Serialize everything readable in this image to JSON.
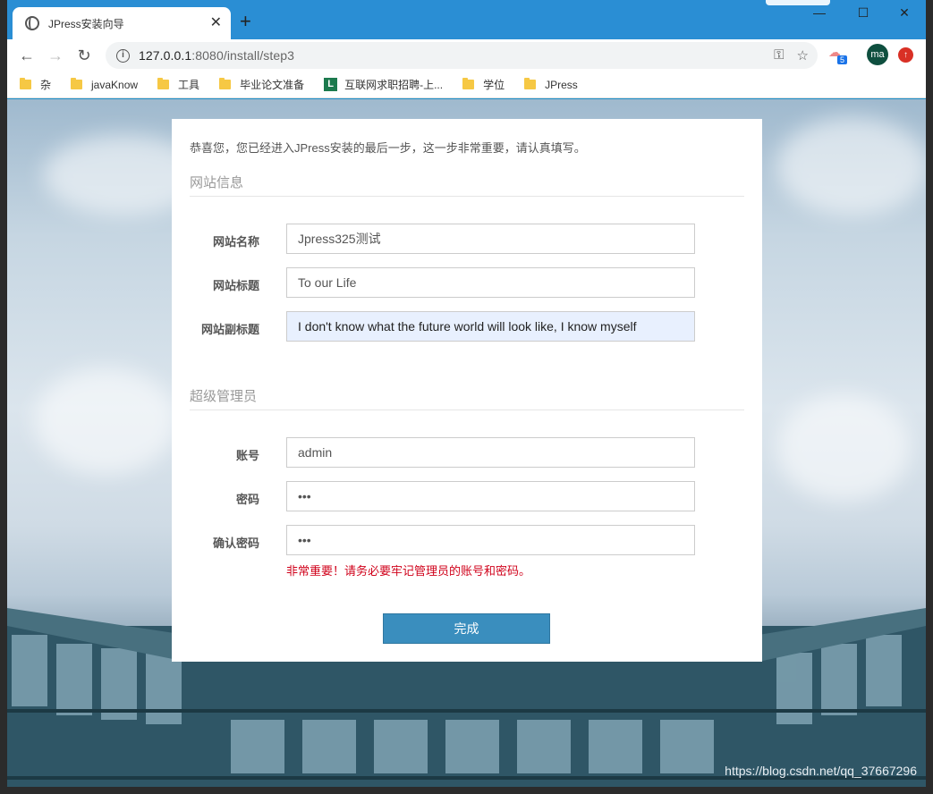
{
  "browser": {
    "tab_title": "JPress安装向导",
    "tab_close": "✕",
    "new_tab": "+",
    "url_host": "127.0.0.1",
    "url_path": ":8080/install/step3",
    "extension_badge": "5",
    "profile_initials": "ma",
    "win_minimize": "—",
    "win_maximize": "☐",
    "win_close": "✕"
  },
  "bookmarks": [
    {
      "label": "杂",
      "icon": "folder-icon"
    },
    {
      "label": "javaKnow",
      "icon": "folder-icon"
    },
    {
      "label": "工具",
      "icon": "folder-icon"
    },
    {
      "label": "毕业论文准备",
      "icon": "folder-icon"
    },
    {
      "label": "互联网求职招聘-上...",
      "icon": "l-logo-icon"
    },
    {
      "label": "学位",
      "icon": "folder-icon"
    },
    {
      "label": "JPress",
      "icon": "folder-icon"
    }
  ],
  "installer": {
    "intro": "恭喜您，您已经进入JPress安装的最后一步，这一步非常重要，请认真填写。",
    "site_section_title": "网站信息",
    "site_name_label": "网站名称",
    "site_name_value": "Jpress325测试",
    "site_title_label": "网站标题",
    "site_title_value": "To our Life",
    "site_subtitle_label": "网站副标题",
    "site_subtitle_value": "I don't know what the future world will look like,  I know myself",
    "admin_section_title": "超级管理员",
    "account_label": "账号",
    "account_value": "admin",
    "password_label": "密码",
    "password_value": "•••",
    "confirm_label": "确认密码",
    "confirm_value": "•••",
    "warning": "非常重要！请务必要牢记管理员的账号和密码。",
    "submit_label": "完成"
  },
  "watermark": "https://blog.csdn.net/qq_37667296",
  "colors": {
    "primary_button": "#3a8ebe",
    "warning_text": "#d0021b",
    "tab_strip": "#2a8ed4"
  }
}
